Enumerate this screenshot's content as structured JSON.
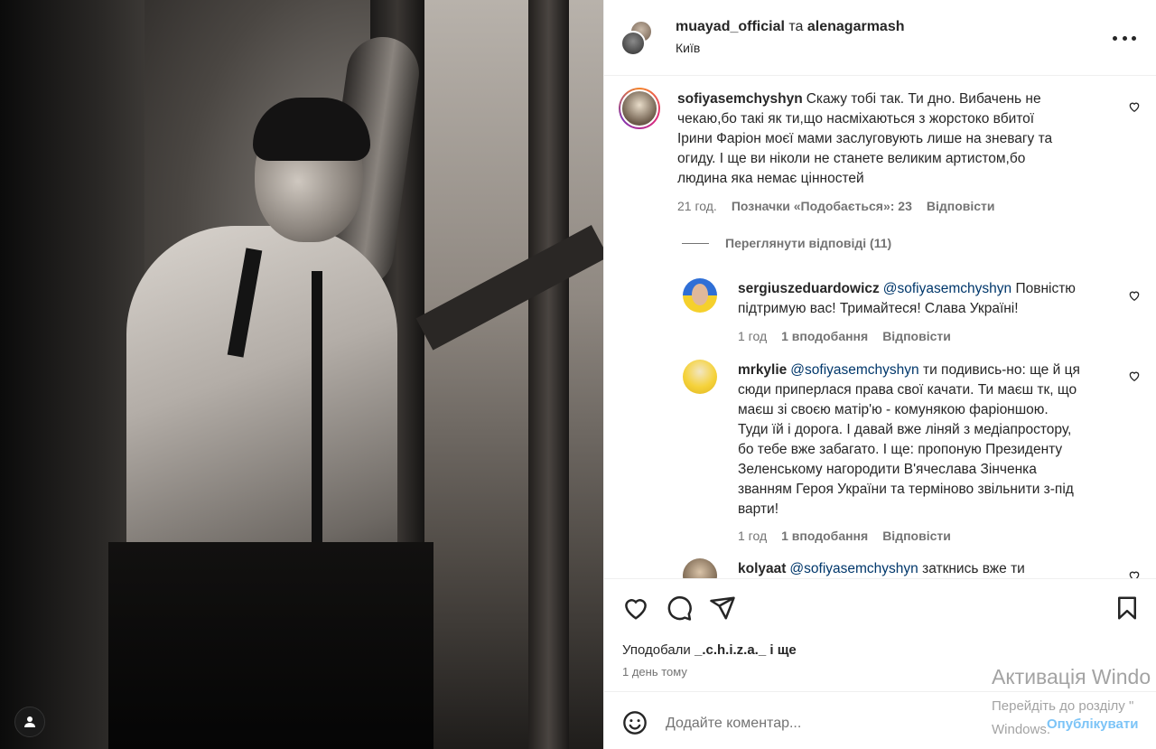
{
  "post": {
    "author_line": {
      "user1": "muayad_official",
      "joiner": " та ",
      "user2": "alenagarmash"
    },
    "location": "Київ"
  },
  "comments": [
    {
      "username": "sofiyasemchyshyn",
      "lines": [
        "Скажу тобі так. Ти дно. Вибачень не",
        "чекаю,бо такі як ти,що насміхаються з жорстоко вбитої",
        "Ірини Фаріон моєї мами заслуговують лише на зневагу та",
        "огиду. І ще ви ніколи не станете великим артистом,бо",
        "людина яка немає цінностей"
      ],
      "time": "21 год.",
      "likes": "Позначки «Подобається»: 23",
      "reply": "Відповісти"
    }
  ],
  "view_replies": "Переглянути відповіді (11)",
  "replies": [
    {
      "username": "sergiuszeduardowicz",
      "mention": "@sofiyasemchyshyn",
      "lines": [
        "Повністю",
        "підтримую вас! Тримайтеся! Слава Україні!"
      ],
      "time": "1 год",
      "likes": "1 вподобання",
      "reply": "Відповісти"
    },
    {
      "username": "mrkylie",
      "mention": "@sofiyasemchyshyn",
      "lines": [
        "ти подивись-но: ще й ця",
        "сюди приперлася права свої качати. Ти маєш тк, що",
        "маєш зі своєю матір'ю - комунякою фаріоншою.",
        "Туди їй і дорога. І давай вже ліняй з медіапростору,",
        "бо тебе вже забагато. І ще: пропоную Президенту",
        "Зеленському нагородити В'ячеслава Зінченка",
        "званням Героя України та терміново звільнити з-під",
        "варти!"
      ],
      "time": "1 год",
      "likes": "1 вподобання",
      "reply": "Відповісти"
    },
    {
      "username": "kolyaat",
      "mention": "@sofiyasemchyshyn",
      "lines": [
        "заткнись вже ти"
      ]
    }
  ],
  "likes_summary": {
    "prefix": "Уподобали ",
    "user": "_.c.h.i.z.a._",
    "suffix": " і ще"
  },
  "post_date": "1 день тому",
  "add_comment": {
    "placeholder": "Додайте коментар...",
    "post_label": "Опублікувати"
  },
  "windows_watermark": {
    "title": "Активація Windo",
    "line1": "Перейдіть до розділу \"",
    "line2": "Windows."
  },
  "colors": {
    "link": "#00376b",
    "muted": "#737373",
    "text": "#262626",
    "post_btn": "#7cc4f7"
  }
}
